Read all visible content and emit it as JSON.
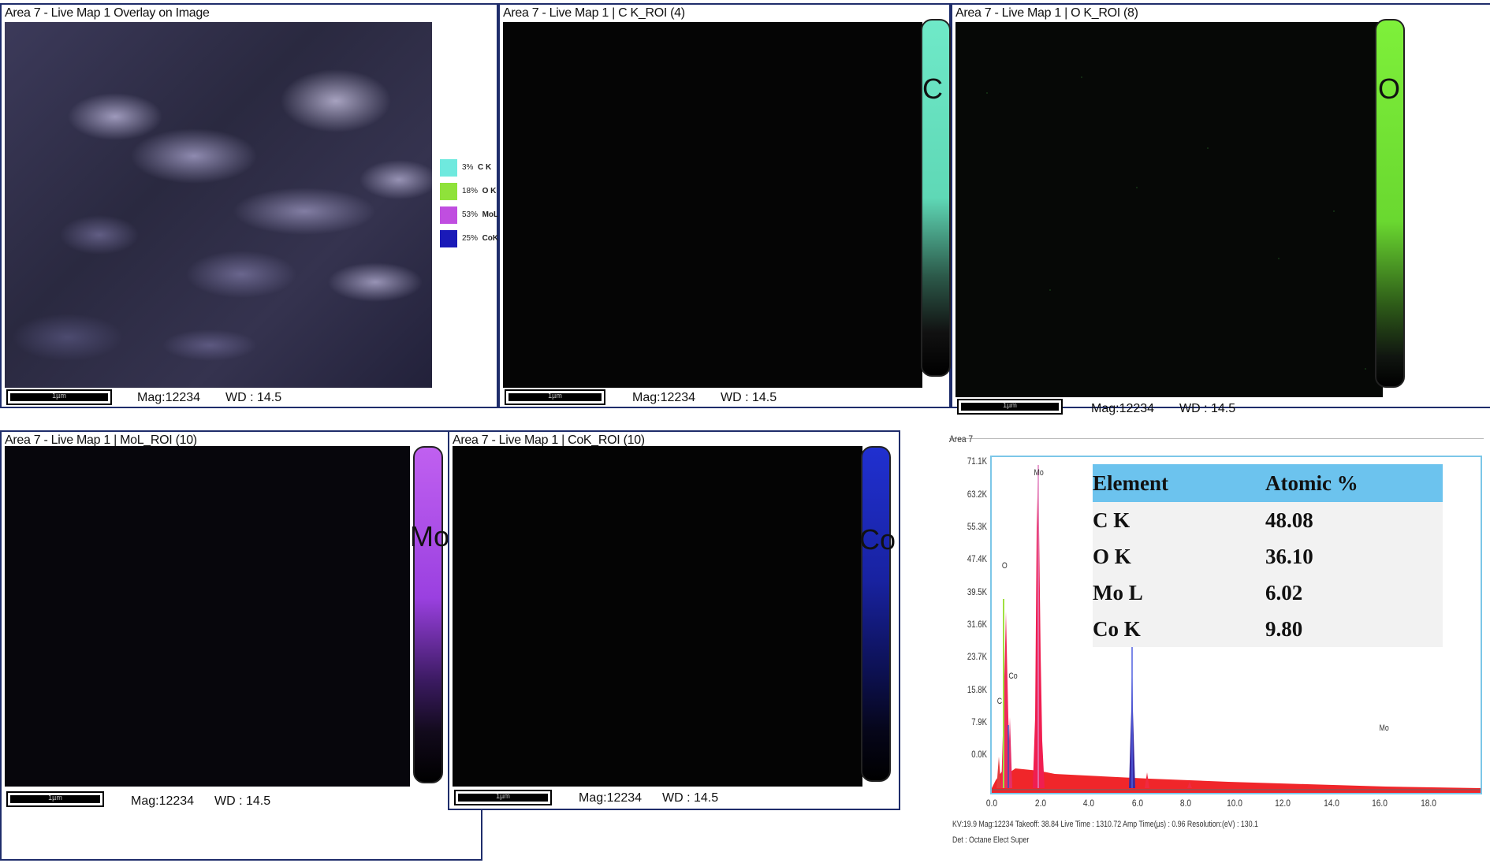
{
  "panels": {
    "overlay": {
      "title": "Area 7 - Live Map 1 Overlay on Image",
      "scale": "1µm",
      "mag": "Mag:12234",
      "wd": "WD : 14.5"
    },
    "c_map": {
      "title": "Area 7 - Live Map 1 | C K_ROI (4)",
      "scale": "1µm",
      "mag": "Mag:12234",
      "wd": "WD : 14.5",
      "element": "C",
      "color": "#6fe9c8"
    },
    "o_map": {
      "title": "Area 7 - Live Map 1 | O K_ROI (8)",
      "scale": "1µm",
      "mag": "Mag:12234",
      "wd": "WD : 14.5",
      "element": "O",
      "color": "#7ef03a"
    },
    "mo_map": {
      "title": "Area 7 - Live Map 1 | MoL_ROI (10)",
      "scale": "1µm",
      "mag": "Mag:12234",
      "wd": "WD : 14.5",
      "element": "Mo",
      "color": "#b04cf2"
    },
    "co_map": {
      "title": "Area 7 - Live Map 1 | CoK_ROI (10)",
      "scale": "1µm",
      "mag": "Mag:12234",
      "wd": "WD : 14.5",
      "element": "Co",
      "color": "#2030d0"
    }
  },
  "legend": [
    {
      "pct": "3%",
      "label": "C K",
      "color": "#6fe9de"
    },
    {
      "pct": "18%",
      "label": "O K",
      "color": "#8fe23a"
    },
    {
      "pct": "53%",
      "label": "MoL",
      "color": "#c04ee0"
    },
    {
      "pct": "25%",
      "label": "CoK",
      "color": "#1a1ab8"
    }
  ],
  "spectrum": {
    "title": "Area 7",
    "y_ticks": [
      "71.1K",
      "63.2K",
      "55.3K",
      "47.4K",
      "39.5K",
      "31.6K",
      "23.7K",
      "15.8K",
      "7.9K",
      "0.0K"
    ],
    "x_ticks": [
      "0.0",
      "2.0",
      "4.0",
      "6.0",
      "8.0",
      "10.0",
      "12.0",
      "14.0",
      "16.0",
      "18.0"
    ],
    "peak_labels": {
      "mo_main": "Mo",
      "o": "O",
      "co_low": "Co",
      "c": "C",
      "co_main": "Co",
      "mo_high": "Mo"
    },
    "status_line1": "KV:19.9    Mag:12234    Takeoff: 38.84    Live Time : 1310.72    Amp Time(µs) : 0.96    Resolution:(eV) : 130.1",
    "status_line2": "Det : Octane Elect Super"
  },
  "atomic_table": {
    "headers": [
      "Element",
      "Atomic %"
    ],
    "rows": [
      {
        "element": "C K",
        "value": "48.08"
      },
      {
        "element": "O K",
        "value": "36.10"
      },
      {
        "element": "Mo L",
        "value": "6.02"
      },
      {
        "element": "Co K",
        "value": "9.80"
      }
    ]
  }
}
